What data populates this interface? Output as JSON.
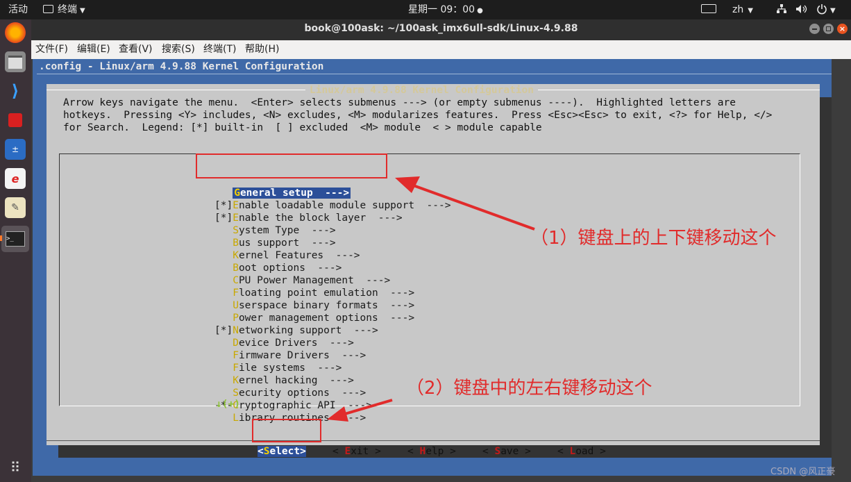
{
  "topbar": {
    "activities": "活动",
    "terminal_app": "终端",
    "clock": "星期一 09：00",
    "lang": "zh"
  },
  "window": {
    "title": "book@100ask: ~/100ask_imx6ull-sdk/Linux-4.9.88"
  },
  "menubar": [
    "文件(F)",
    "编辑(E)",
    "查看(V)",
    "搜索(S)",
    "终端(T)",
    "帮助(H)"
  ],
  "terminal": {
    "header": ".config - Linux/arm 4.9.88 Kernel Configuration",
    "dialog_title": "Linux/arm 4.9.88 Kernel Configuration",
    "help_lines": [
      "Arrow keys navigate the menu.  <Enter> selects submenus ---> (or empty submenus ----).  Highlighted letters are",
      "hotkeys.  Pressing <Y> includes, <N> excludes, <M> modularizes features.  Press <Esc><Esc> to exit, <?> for Help, </>",
      "for Search.  Legend: [*] built-in  [ ] excluded  <M> module  < > module capable"
    ],
    "menu_items": [
      {
        "prefix": "   ",
        "hotkey": "G",
        "rest": "eneral setup  --->",
        "selected": true
      },
      {
        "prefix": "[*]",
        "hotkey": "E",
        "rest": "nable loadable module support  --->",
        "selected": false
      },
      {
        "prefix": "[*]",
        "hotkey": "E",
        "rest": "nable the block layer  --->",
        "selected": false
      },
      {
        "prefix": "   ",
        "hotkey": "S",
        "rest": "ystem Type  --->",
        "selected": false
      },
      {
        "prefix": "   ",
        "hotkey": "B",
        "rest": "us support  --->",
        "selected": false
      },
      {
        "prefix": "   ",
        "hotkey": "K",
        "rest": "ernel Features  --->",
        "selected": false
      },
      {
        "prefix": "   ",
        "hotkey": "B",
        "rest": "oot options  --->",
        "selected": false
      },
      {
        "prefix": "   ",
        "hotkey": "C",
        "rest": "PU Power Management  --->",
        "selected": false
      },
      {
        "prefix": "   ",
        "hotkey": "F",
        "rest": "loating point emulation  --->",
        "selected": false
      },
      {
        "prefix": "   ",
        "hotkey": "U",
        "rest": "serspace binary formats  --->",
        "selected": false
      },
      {
        "prefix": "   ",
        "hotkey": "P",
        "rest": "ower management options  --->",
        "selected": false
      },
      {
        "prefix": "[*]",
        "hotkey": "N",
        "rest": "etworking support  --->",
        "selected": false
      },
      {
        "prefix": "   ",
        "hotkey": "D",
        "rest": "evice Drivers  --->",
        "selected": false
      },
      {
        "prefix": "   ",
        "hotkey": "F",
        "rest": "irmware Drivers  --->",
        "selected": false
      },
      {
        "prefix": "   ",
        "hotkey": "F",
        "rest": "ile systems  --->",
        "selected": false
      },
      {
        "prefix": "   ",
        "hotkey": "K",
        "rest": "ernel hacking  --->",
        "selected": false
      },
      {
        "prefix": "   ",
        "hotkey": "S",
        "rest": "ecurity options  --->",
        "selected": false
      },
      {
        "prefix": "-*-",
        "hotkey": "C",
        "rest": "ryptographic API  --->",
        "selected": false
      },
      {
        "prefix": "   ",
        "hotkey": "L",
        "rest": "ibrary routines  --->",
        "selected": false
      }
    ],
    "more_indicator": "↓(+)",
    "buttons": [
      {
        "lt": "<",
        "hotkey": "S",
        "rest": "elect",
        "gt": ">",
        "selected": true
      },
      {
        "lt": "< ",
        "hotkey": "E",
        "rest": "xit",
        "gt": " >",
        "selected": false
      },
      {
        "lt": "< ",
        "hotkey": "H",
        "rest": "elp",
        "gt": " >",
        "selected": false
      },
      {
        "lt": "< ",
        "hotkey": "S",
        "rest": "ave",
        "gt": " >",
        "selected": false
      },
      {
        "lt": "< ",
        "hotkey": "L",
        "rest": "oad",
        "gt": " >",
        "selected": false
      }
    ]
  },
  "annotations": {
    "note1": "（1）键盘上的上下键移动这个",
    "note2": "（2）键盘中的左右键移动这个"
  },
  "watermark": "CSDN @风正豪",
  "colors": {
    "terminal_bg": "#3f69a8",
    "dialog_bg": "#c8c8c8",
    "hotkey": "#c8a800",
    "selection": "#2c4f99",
    "annotation_red": "#e12b2b"
  }
}
